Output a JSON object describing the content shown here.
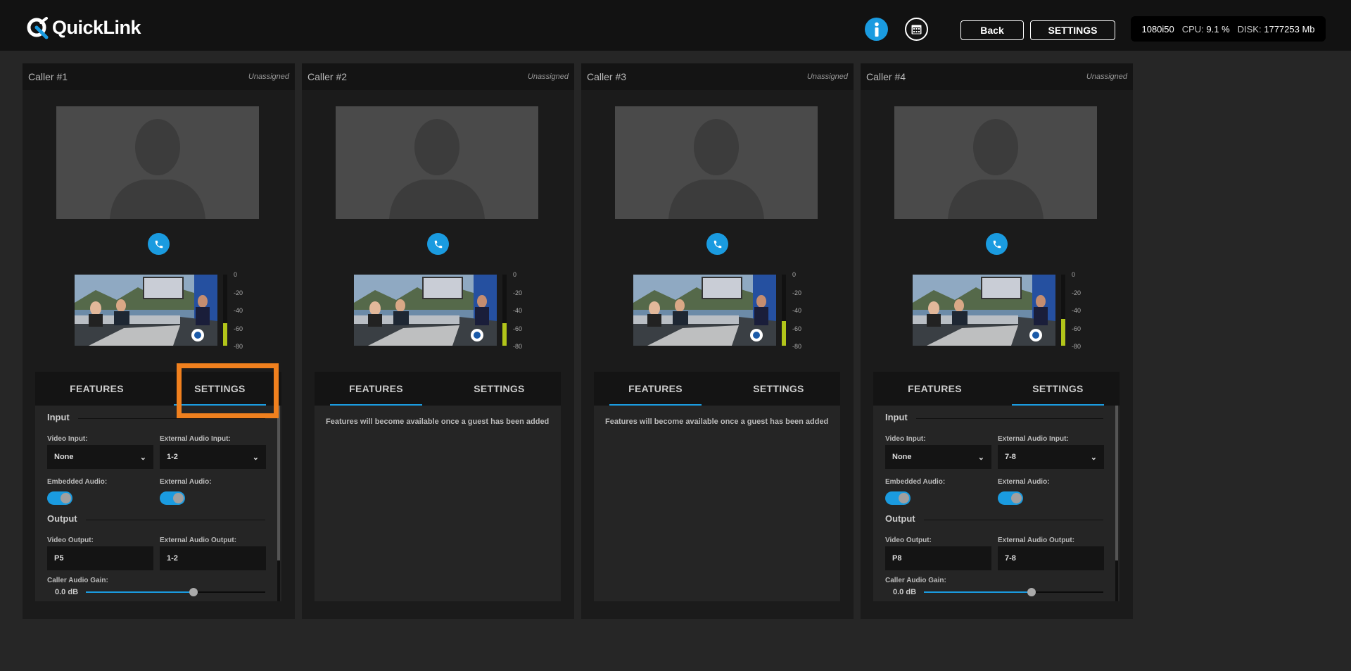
{
  "app": {
    "logo_text": "QuickLink"
  },
  "header": {
    "back_label": "Back",
    "settings_label": "SETTINGS",
    "status": {
      "format": "1080i50",
      "cpu_label": "CPU:",
      "cpu_value": "9.1 %",
      "disk_label": "DISK:",
      "disk_value": "1777253 Mb"
    }
  },
  "meter_scale": [
    "0",
    "-20",
    "-40",
    "-60",
    "-80"
  ],
  "empty_message": "Features will become available once a guest has been added",
  "settings_labels": {
    "input": "Input",
    "video_input": "Video Input:",
    "ext_audio_input": "External Audio Input:",
    "embedded_audio": "Embedded Audio:",
    "external_audio": "External Audio:",
    "output": "Output",
    "video_output": "Video Output:",
    "ext_audio_output": "External Audio Output:",
    "caller_gain": "Caller Audio Gain:"
  },
  "callers": [
    {
      "title": "Caller #1",
      "assignment": "Unassigned",
      "tab_features": "FEATURES",
      "tab_settings": "SETTINGS",
      "active_tab": "settings",
      "meter_level": 0.32,
      "settings": {
        "video_input": "None",
        "ext_audio_input": "1-2",
        "embedded_audio": true,
        "external_audio": true,
        "video_output": "P5",
        "ext_audio_output": "1-2",
        "gain": "0.0 dB",
        "gain_fraction": 0.6
      }
    },
    {
      "title": "Caller #2",
      "assignment": "Unassigned",
      "tab_features": "FEATURES",
      "tab_settings": "SETTINGS",
      "active_tab": "features",
      "meter_level": 0.32
    },
    {
      "title": "Caller #3",
      "assignment": "Unassigned",
      "tab_features": "FEATURES",
      "tab_settings": "SETTINGS",
      "active_tab": "features",
      "meter_level": 0.35
    },
    {
      "title": "Caller #4",
      "assignment": "Unassigned",
      "tab_features": "FEATURES",
      "tab_settings": "SETTINGS",
      "active_tab": "settings",
      "meter_level": 0.38,
      "settings": {
        "video_input": "None",
        "ext_audio_input": "7-8",
        "embedded_audio": true,
        "external_audio": true,
        "video_output": "P8",
        "ext_audio_output": "7-8",
        "gain": "0.0 dB",
        "gain_fraction": 0.6
      }
    }
  ],
  "colors": {
    "accent": "#1a9be0",
    "highlight": "#f0801e",
    "meter": "#b2c51a"
  }
}
